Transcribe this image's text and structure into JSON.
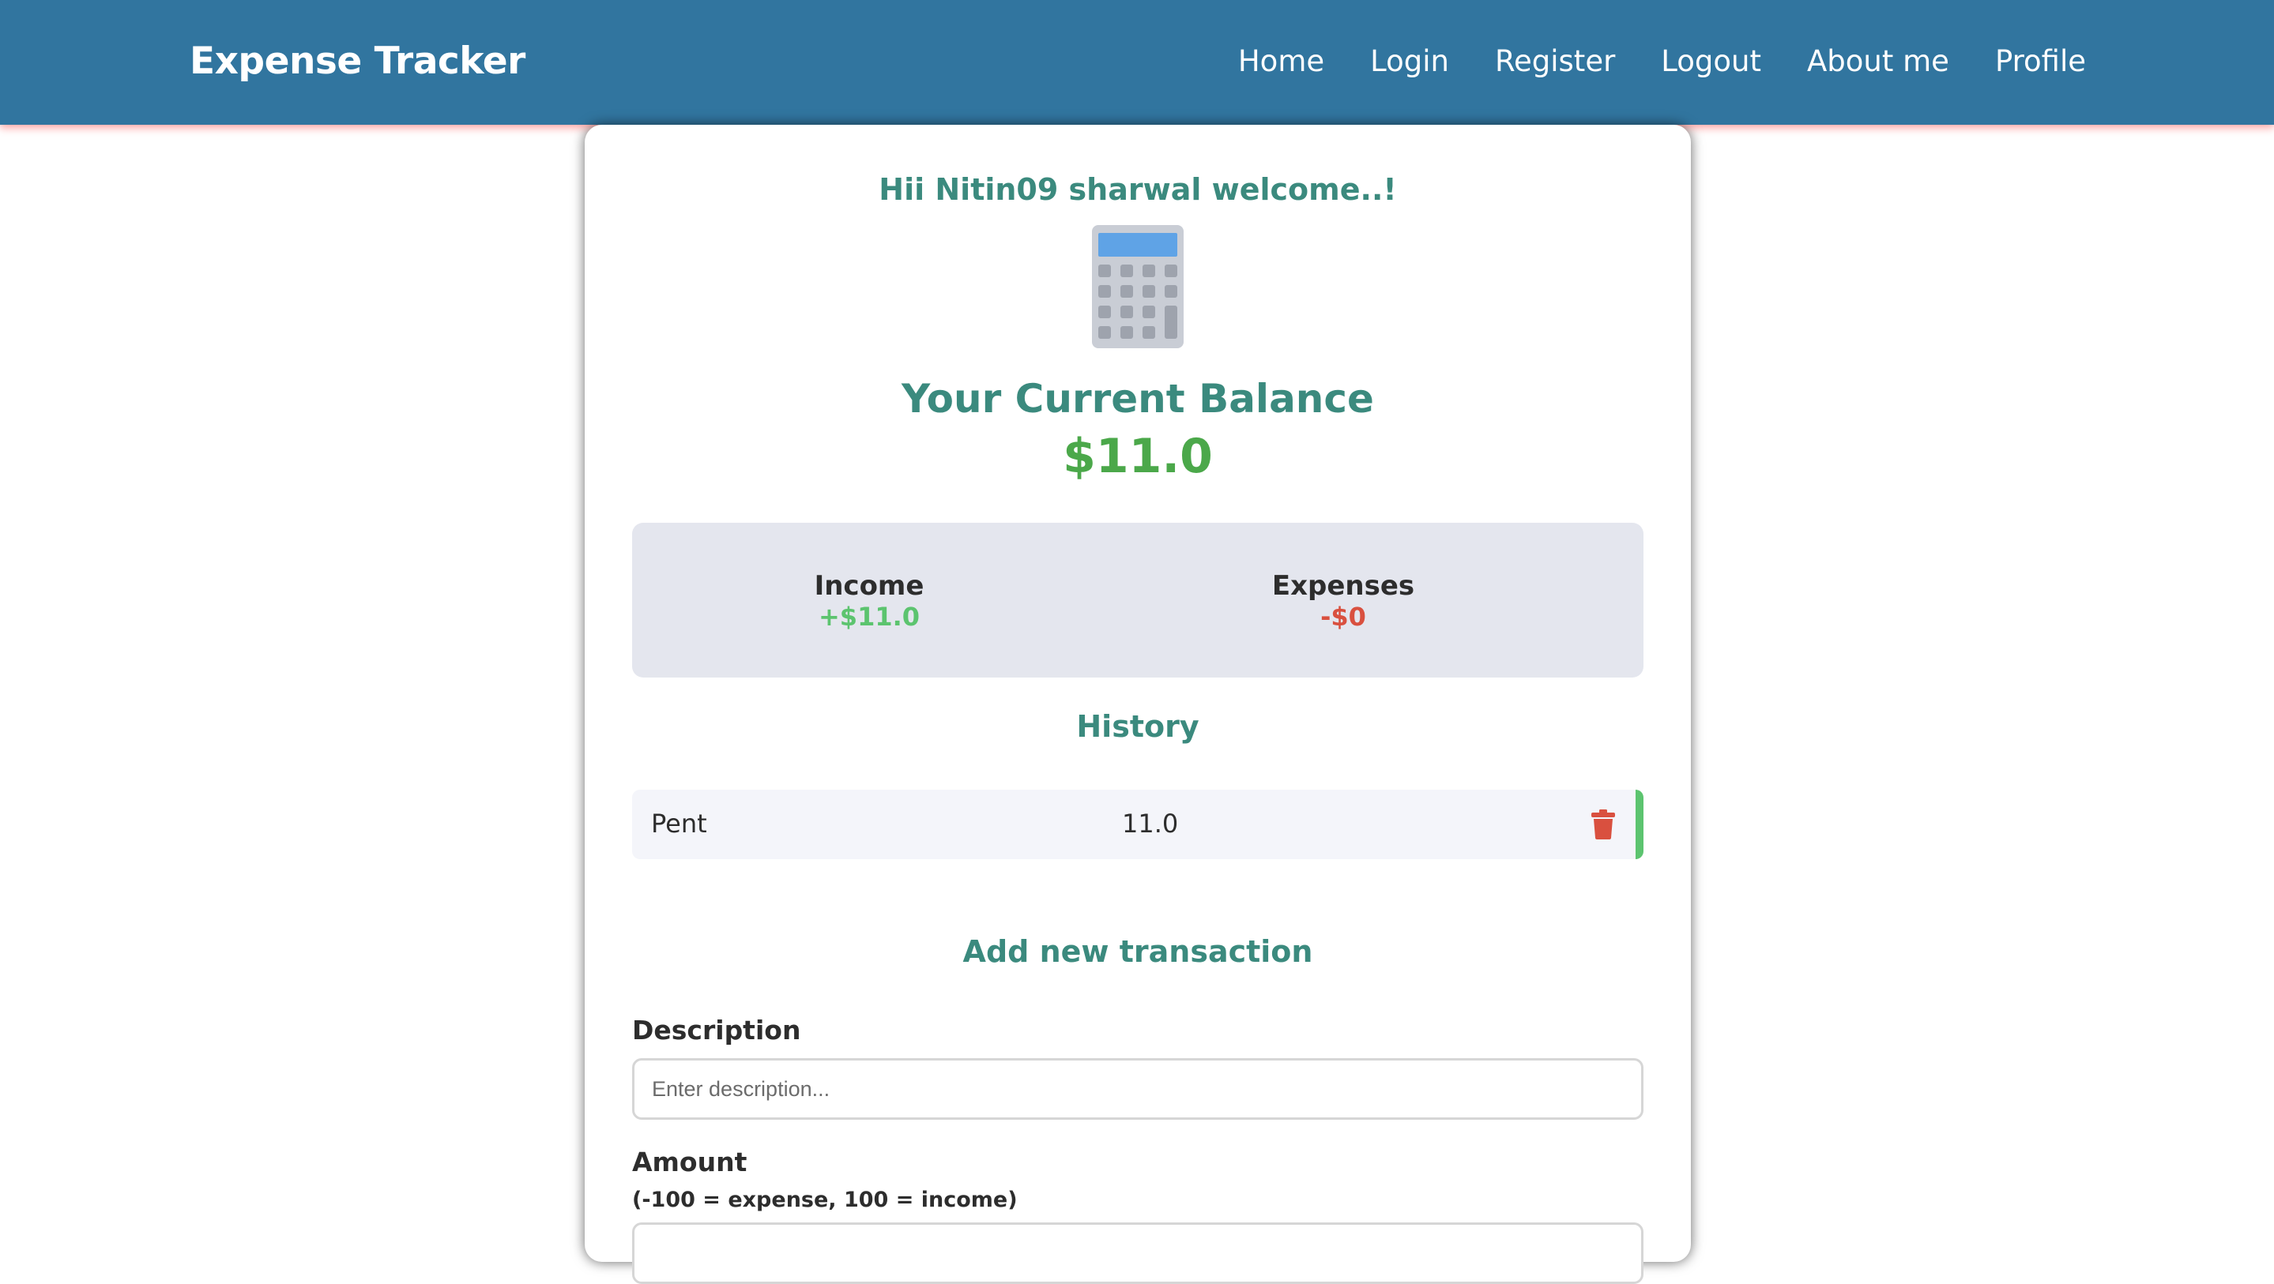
{
  "navbar": {
    "brand": "Expense Tracker",
    "links": [
      "Home",
      "Login",
      "Register",
      "Logout",
      "About me",
      "Profile"
    ],
    "background_color": "#31759f"
  },
  "greeting": "Hii Nitin09 sharwal welcome..!",
  "balance": {
    "title": "Your Current Balance",
    "amount": "$11.0"
  },
  "summary": {
    "income_label": "Income",
    "income_value": "+$11.0",
    "expenses_label": "Expenses",
    "expenses_value": "-$0"
  },
  "history": {
    "title": "History",
    "items": [
      {
        "description": "Pent",
        "amount": "11.0",
        "type": "income"
      }
    ]
  },
  "form": {
    "title": "Add new transaction",
    "description_label": "Description",
    "description_placeholder": "Enter description...",
    "description_value": "",
    "amount_label": "Amount",
    "amount_hint": "(-100 = expense, 100 = income)"
  },
  "icons": {
    "header_icon": "calculator-icon",
    "row_action_icon": "trash-icon"
  },
  "colors": {
    "accent": "#3b8a7e",
    "income": "#5cc46f",
    "expense": "#d9503f",
    "balance": "#4ba84a"
  }
}
